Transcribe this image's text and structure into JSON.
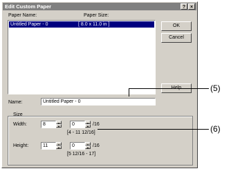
{
  "window": {
    "title": "Edit Custom Paper",
    "help_glyph": "?",
    "close_glyph": "×"
  },
  "list": {
    "header_name": "Paper Name:",
    "header_size": "Paper Size:",
    "rows": [
      {
        "name": "Untitled Paper - 0",
        "size": "[ 8.0 x 11.0 in ]"
      }
    ]
  },
  "buttons": {
    "ok": "OK",
    "cancel": "Cancel",
    "help": "Help"
  },
  "name_field": {
    "label": "Name:",
    "value": "Untitled Paper - 0"
  },
  "size_group": {
    "title": "Size",
    "width": {
      "label": "Width:",
      "whole": "8",
      "fraction": "0",
      "unit": "/16",
      "range": "[4 - 11 12/16]"
    },
    "height": {
      "label": "Height:",
      "whole": "11",
      "fraction": "0",
      "unit": "/16",
      "range": "[5 12/16 - 17]"
    }
  },
  "callouts": {
    "first": "(5)",
    "second": "(6)"
  },
  "icons": {
    "spin_up": "▲",
    "spin_down": "▼"
  }
}
